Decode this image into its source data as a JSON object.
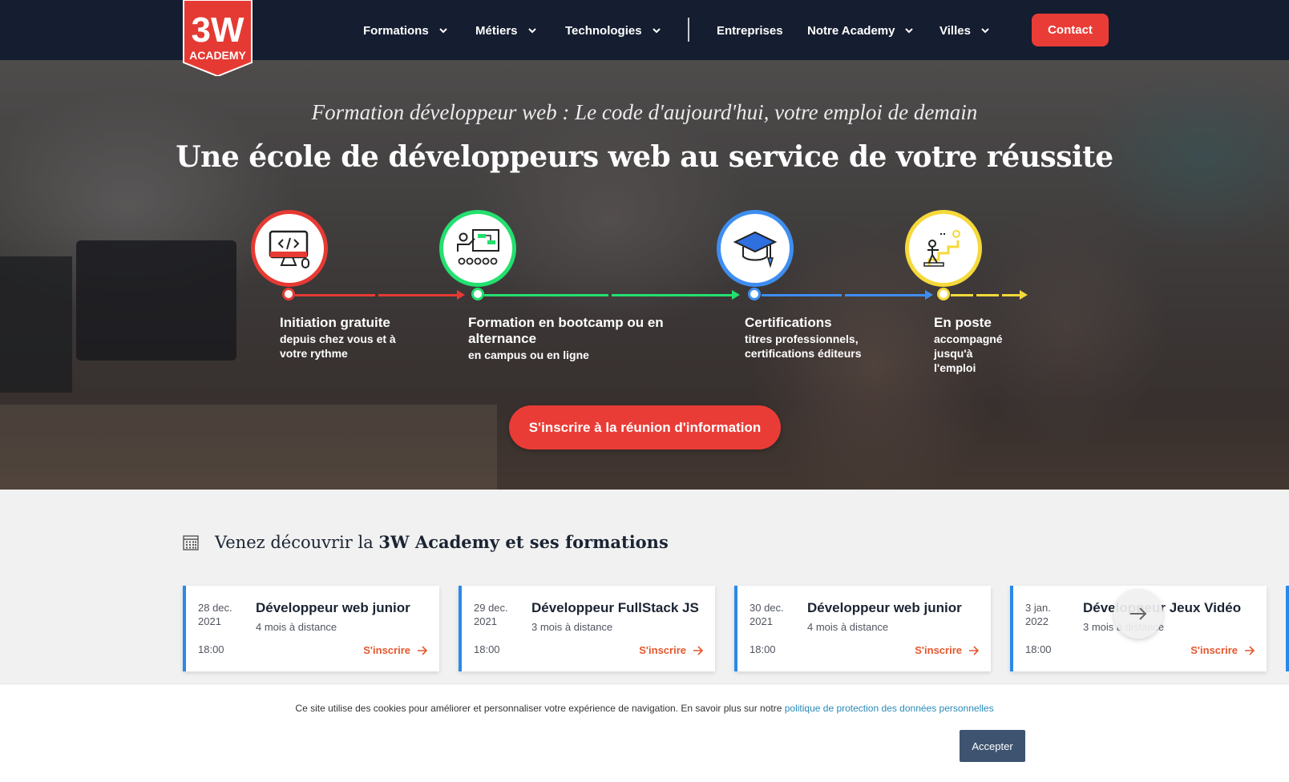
{
  "brand": {
    "logo_number": "3W",
    "logo_word": "ACADEMY",
    "logo_color": "#e53a33"
  },
  "nav": {
    "items": [
      {
        "label": "Formations",
        "dropdown": true
      },
      {
        "label": "Métiers",
        "dropdown": true
      },
      {
        "label": "Technologies",
        "dropdown": true
      },
      {
        "label": "Entreprises",
        "dropdown": false
      },
      {
        "label": "Notre Academy",
        "dropdown": true
      },
      {
        "label": "Villes",
        "dropdown": true
      }
    ],
    "contact_label": "Contact"
  },
  "hero": {
    "subtitle": "Formation développeur web : Le code d'aujourd'hui, votre emploi de demain",
    "title": "Une école de développeurs web au service de votre réussite",
    "steps": [
      {
        "title": "Initiation gratuite",
        "desc": "depuis chez vous et à votre rythme",
        "color": "#e63a33",
        "icon": "code-monitor-icon"
      },
      {
        "title": "Formation en bootcamp ou en alternance",
        "desc": "en campus ou en ligne",
        "color": "#23e06f",
        "icon": "classroom-presentation-icon"
      },
      {
        "title": "Certifications",
        "desc": "titres professionnels, certifications éditeurs",
        "color": "#3e8ef1",
        "icon": "graduation-cap-icon"
      },
      {
        "title": "En poste",
        "desc": "accompagné jusqu'à l'emploi",
        "color": "#f5d93a",
        "icon": "career-stairs-icon"
      }
    ],
    "cta_label": "S'inscrire à la réunion d'information"
  },
  "events": {
    "heading_prefix": "Venez découvrir la ",
    "heading_bold": "3W Academy et ses formations",
    "enroll_label": "S'inscrire",
    "cards": [
      {
        "date": "28 dec. 2021",
        "time": "18:00",
        "title": "Développeur web junior",
        "duration": "4 mois à distance"
      },
      {
        "date": "29 dec. 2021",
        "time": "18:00",
        "title": "Développeur FullStack JS",
        "duration": "3 mois à distance"
      },
      {
        "date": "30 dec. 2021",
        "time": "18:00",
        "title": "Développeur web junior",
        "duration": "4 mois à distance"
      },
      {
        "date": "3 jan. 2022",
        "time": "18:00",
        "title": "Développeur Jeux Vidéo",
        "duration": "3 mois à distance"
      }
    ]
  },
  "cookie": {
    "text": "Ce site utilise des cookies pour améliorer et personnaliser votre expérience de navigation. En savoir plus sur notre ",
    "link": "politique de protection des données personnelles",
    "accept_label": "Accepter"
  }
}
